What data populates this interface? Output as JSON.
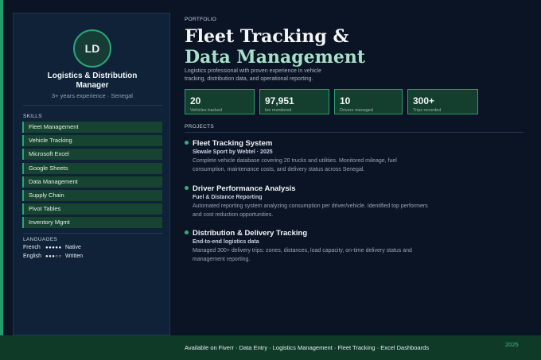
{
  "colors": {
    "accent": "#2aa679",
    "title_accent": "#a6e0c8",
    "background": "#0b1424",
    "panel": "#0f2238",
    "footer": "#0f3a28"
  },
  "profile": {
    "initials": "LD",
    "role_line1": "Logistics & Distribution",
    "role_line2": "Manager",
    "experience": "3+ years experience · Senegal"
  },
  "skills_label": "SKILLS",
  "skills": [
    "Fleet Management",
    "Vehicle Tracking",
    "Microsoft Excel",
    "Google Sheets",
    "Data Management",
    "Supply Chain",
    "Pivot Tables",
    "Inventory Mgmt"
  ],
  "languages_label": "LANGUAGES",
  "languages": [
    {
      "name": "French",
      "dots": "●●●●●",
      "level": "Native"
    },
    {
      "name": "English",
      "dots": "●●●○○",
      "level": "Written"
    }
  ],
  "header": {
    "eyebrow": "PORTFOLIO",
    "title_line1": "Fleet Tracking &",
    "title_line2": "Data Management",
    "intro": "Logistics professional with proven experience in vehicle tracking, distribution data, and operational reporting."
  },
  "stats": [
    {
      "value": "20",
      "label": "Vehicles tracked"
    },
    {
      "value": "97,951",
      "label": "km monitored"
    },
    {
      "value": "10",
      "label": "Drivers managed"
    },
    {
      "value": "300+",
      "label": "Trips recorded"
    }
  ],
  "projects_label": "PROJECTS",
  "projects": [
    {
      "title": "Fleet Tracking System",
      "subtitle": "Skwale Sport by Webtel · 2025",
      "description": "Complete vehicle database covering 20 trucks and utilities. Monitored mileage, fuel consumption, maintenance costs, and delivery status across Senegal."
    },
    {
      "title": "Driver Performance Analysis",
      "subtitle": "Fuel & Distance Reporting",
      "description": "Automated reporting system analyzing consumption per driver/vehicle. Identified top performers and cost reduction opportunities."
    },
    {
      "title": "Distribution & Delivery Tracking",
      "subtitle": "End-to-end logistics data",
      "description": "Managed 300+ delivery trips: zones, distances, load capacity, on-time delivery status and management reporting."
    }
  ],
  "footer": {
    "text": "Available on Fiverr  ·  Data Entry  ·  Logistics Management  ·  Fleet Tracking  ·  Excel Dashboards",
    "year": "2025"
  }
}
